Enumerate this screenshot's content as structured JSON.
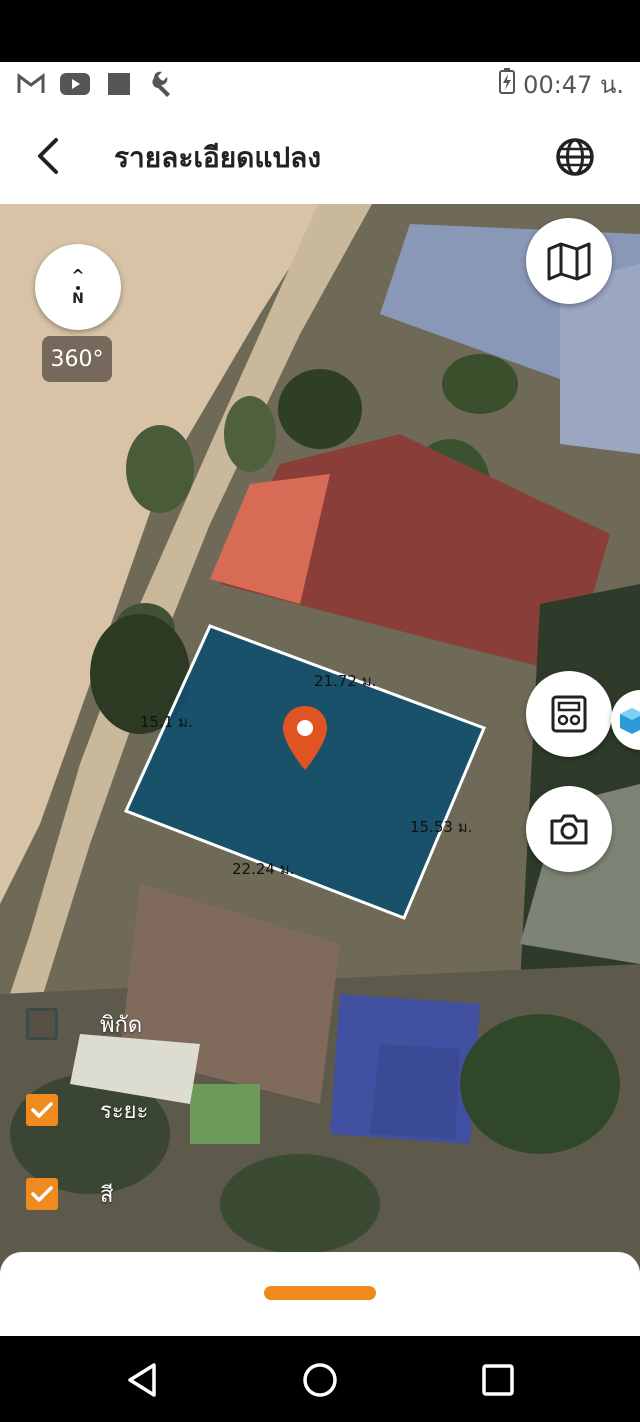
{
  "status_bar": {
    "time": "00:47 น.",
    "icons": [
      "gmail-icon",
      "youtube-icon",
      "stop-square-icon",
      "wrench-icon"
    ],
    "battery_icon": "battery-charging-icon"
  },
  "header": {
    "title": "รายละเอียดแปลง",
    "back_icon": "back-arrow-icon",
    "globe_icon": "globe-icon"
  },
  "map": {
    "compass": {
      "arrow": "^",
      "letter": "N"
    },
    "rotate_label": "360°",
    "plot": {
      "edges": [
        "21.72 ม.",
        "15.1 ม.",
        "15.53 ม.",
        "22.24 ม."
      ],
      "fill_color": "#0f4f6e",
      "border_color": "#ffffff",
      "pin_color": "#e05424"
    },
    "layers": [
      {
        "label": "พิกัด",
        "checked": false
      },
      {
        "label": "ระยะ",
        "checked": true
      },
      {
        "label": "สี",
        "checked": true
      }
    ]
  },
  "accent_color": "#ef8a1e",
  "bottom_sheet": {
    "handle": "drag-handle"
  },
  "nav": {
    "back": "nav-back-icon",
    "home": "nav-home-icon",
    "recents": "nav-recents-icon"
  }
}
